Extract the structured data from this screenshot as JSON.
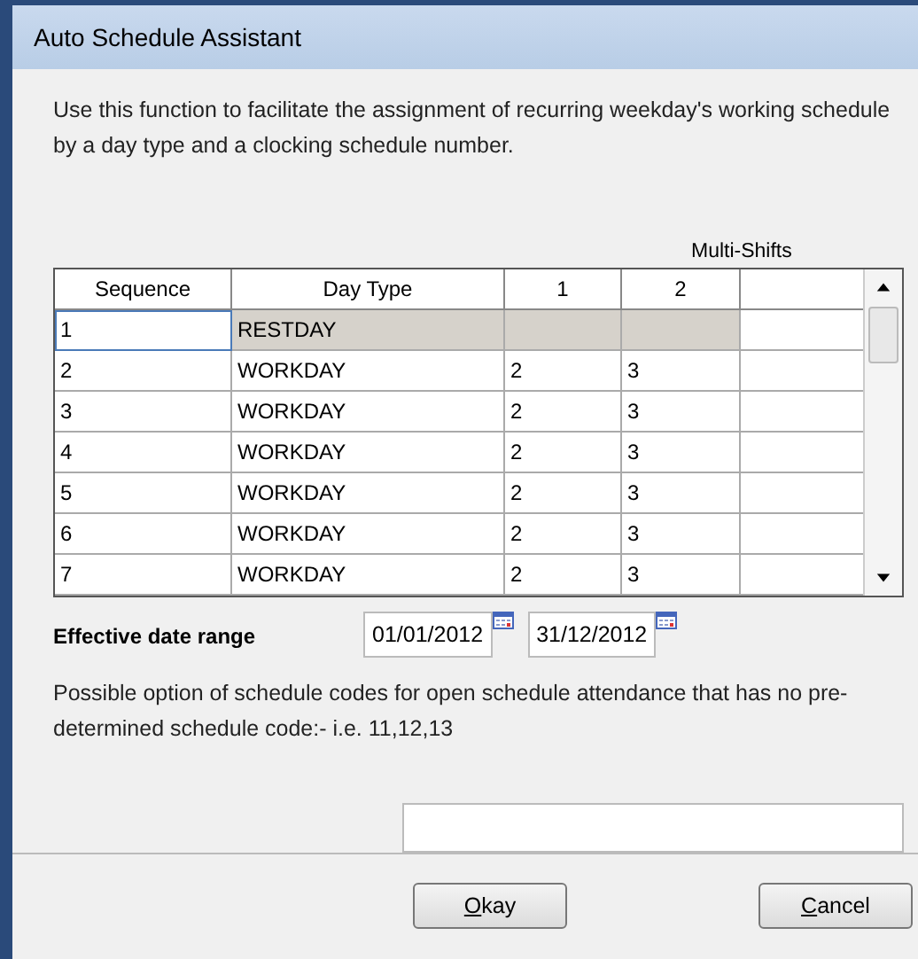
{
  "window": {
    "title": "Auto Schedule Assistant"
  },
  "description": "Use this function to facilitate the assignment of recurring weekday's working schedule by a day type and a clocking schedule number.",
  "table": {
    "group_header": "Multi-Shifts",
    "columns": [
      "Sequence",
      "Day Type",
      "1",
      "2"
    ],
    "rows": [
      {
        "sequence": "1",
        "day_type": "RESTDAY",
        "shift_1": "",
        "shift_2": "",
        "selected": true
      },
      {
        "sequence": "2",
        "day_type": "WORKDAY",
        "shift_1": "2",
        "shift_2": "3",
        "selected": false
      },
      {
        "sequence": "3",
        "day_type": "WORKDAY",
        "shift_1": "2",
        "shift_2": "3",
        "selected": false
      },
      {
        "sequence": "4",
        "day_type": "WORKDAY",
        "shift_1": "2",
        "shift_2": "3",
        "selected": false
      },
      {
        "sequence": "5",
        "day_type": "WORKDAY",
        "shift_1": "2",
        "shift_2": "3",
        "selected": false
      },
      {
        "sequence": "6",
        "day_type": "WORKDAY",
        "shift_1": "2",
        "shift_2": "3",
        "selected": false
      },
      {
        "sequence": "7",
        "day_type": "WORKDAY",
        "shift_1": "2",
        "shift_2": "3",
        "selected": false
      }
    ]
  },
  "date_range": {
    "label": "Effective date range",
    "from": "01/01/2012",
    "to": "31/12/2012"
  },
  "codes_note": "Possible option of schedule codes for open schedule attendance that has no pre-determined schedule code:-  i.e. 11,12,13",
  "buttons": [
    "Okay",
    "Cancel"
  ]
}
